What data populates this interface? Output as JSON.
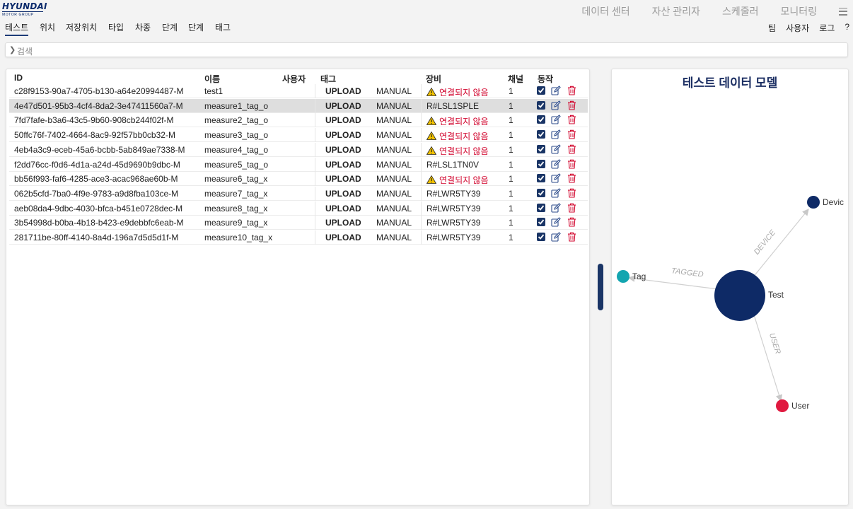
{
  "logo": {
    "main": "HYUNDAI",
    "sub": "MOTOR GROUP"
  },
  "topnav": [
    "데이터 센터",
    "자산 관리자",
    "스케줄러",
    "모니터링"
  ],
  "tabs": [
    "테스트",
    "위치",
    "저장위치",
    "타입",
    "차종",
    "단계",
    "단계",
    "태그"
  ],
  "right_links": [
    "팀",
    "사용자",
    "로그",
    "?"
  ],
  "search": {
    "label": "검색"
  },
  "table": {
    "headers": [
      "ID",
      "이름",
      "사용자",
      "태그",
      "장비",
      "채널",
      "동작"
    ],
    "rows": [
      {
        "id": "c28f9153-90a7-4705-b130-a64e20994487-M",
        "name": "test1",
        "tag": "UPLOAD",
        "mode": "MANUAL",
        "device": "연결되지 않음",
        "warn": true,
        "channel": "1"
      },
      {
        "id": "4e47d501-95b3-4cf4-8da2-3e47411560a7-M",
        "name": "measure1_tag_o",
        "tag": "UPLOAD",
        "mode": "MANUAL",
        "device": "R#LSL1SPLE",
        "warn": false,
        "channel": "1"
      },
      {
        "id": "7fd7fafe-b3a6-43c5-9b60-908cb244f02f-M",
        "name": "measure2_tag_o",
        "tag": "UPLOAD",
        "mode": "MANUAL",
        "device": "연결되지 않음",
        "warn": true,
        "channel": "1"
      },
      {
        "id": "50ffc76f-7402-4664-8ac9-92f57bb0cb32-M",
        "name": "measure3_tag_o",
        "tag": "UPLOAD",
        "mode": "MANUAL",
        "device": "연결되지 않음",
        "warn": true,
        "channel": "1"
      },
      {
        "id": "4eb4a3c9-eceb-45a6-bcbb-5ab849ae7338-M",
        "name": "measure4_tag_o",
        "tag": "UPLOAD",
        "mode": "MANUAL",
        "device": "연결되지 않음",
        "warn": true,
        "channel": "1"
      },
      {
        "id": "f2dd76cc-f0d6-4d1a-a24d-45d9690b9dbc-M",
        "name": "measure5_tag_o",
        "tag": "UPLOAD",
        "mode": "MANUAL",
        "device": "R#LSL1TN0V",
        "warn": false,
        "channel": "1"
      },
      {
        "id": "bb56f993-faf6-4285-ace3-acac968ae60b-M",
        "name": "measure6_tag_x",
        "tag": "UPLOAD",
        "mode": "MANUAL",
        "device": "연결되지 않음",
        "warn": true,
        "channel": "1"
      },
      {
        "id": "062b5cfd-7ba0-4f9e-9783-a9d8fba103ce-M",
        "name": "measure7_tag_x",
        "tag": "UPLOAD",
        "mode": "MANUAL",
        "device": "R#LWR5TY39",
        "warn": false,
        "channel": "1"
      },
      {
        "id": "aeb08da4-9dbc-4030-bfca-b451e0728dec-M",
        "name": "measure8_tag_x",
        "tag": "UPLOAD",
        "mode": "MANUAL",
        "device": "R#LWR5TY39",
        "warn": false,
        "channel": "1"
      },
      {
        "id": "3b54998d-b0ba-4b18-b423-e9debbfc6eab-M",
        "name": "measure9_tag_x",
        "tag": "UPLOAD",
        "mode": "MANUAL",
        "device": "R#LWR5TY39",
        "warn": false,
        "channel": "1"
      },
      {
        "id": "281711be-80ff-4140-8a4d-196a7d5d5d1f-M",
        "name": "measure10_tag_x",
        "tag": "UPLOAD",
        "mode": "MANUAL",
        "device": "R#LWR5TY39",
        "warn": false,
        "channel": "1"
      }
    ]
  },
  "graph": {
    "title": "테스트 데이터 모델",
    "nodes": {
      "test": "Test",
      "tag": "Tag",
      "device": "Devic",
      "user": "User"
    },
    "edges": {
      "tagged": "TAGGED",
      "device": "DEVICE",
      "user": "USER"
    },
    "colors": {
      "test": "#0e2a66",
      "tag": "#13a5b0",
      "device": "#0e2a66",
      "user": "#e0193f"
    }
  },
  "colors": {
    "accent": "#1a3566",
    "warning": "#d1002a"
  }
}
